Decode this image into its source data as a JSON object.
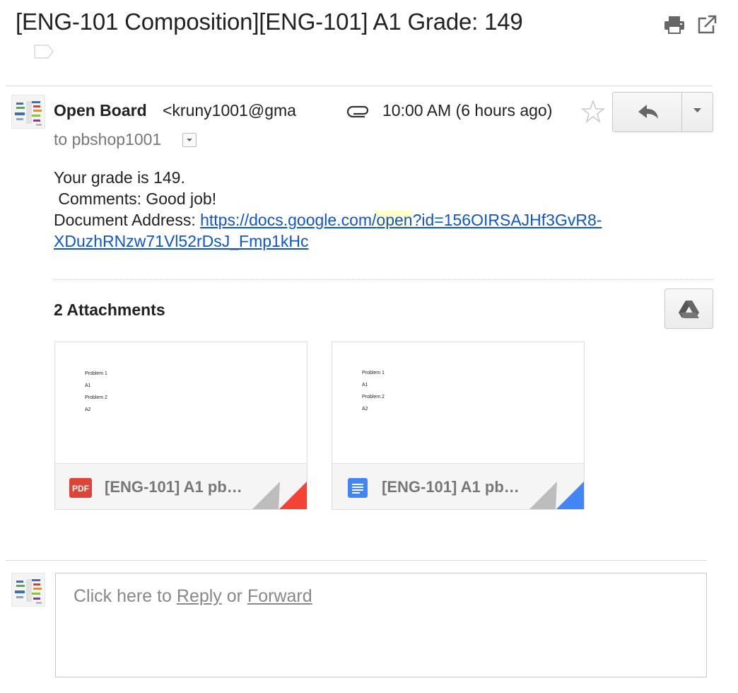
{
  "subject": "[ENG-101 Composition][ENG-101] A1 Grade: 149",
  "icons": {
    "label": "label-tag-icon",
    "print": "print-icon",
    "popout": "open-in-new-window-icon",
    "attachment": "paperclip-icon",
    "star": "star-icon",
    "reply": "reply-arrow-icon",
    "more": "chevron-down-icon",
    "drive": "google-drive-icon"
  },
  "message": {
    "sender_name": "Open Board",
    "sender_email": "<kruny1001@gma",
    "time": "10:00 AM (6 hours ago)",
    "to_line": "to pbshop1001",
    "body": {
      "line1": "Your grade is 149.",
      "line2": " Comments: Good job!",
      "address_label": "Document Address: ",
      "link_part1": "https://docs.google.com/",
      "link_highlight": "open",
      "link_part2": "?id=156OIRSAJHf3GvR8-",
      "link_part3": "XDuzhRNzw71Vl52rDsJ_Fmp1kHc"
    }
  },
  "attachments": {
    "title": "2 Attachments",
    "items": [
      {
        "name": "[ENG-101] A1 pb…",
        "type_badge": "PDF",
        "icon": "pdf-file-icon",
        "preview_lines": [
          "Problem 1",
          "A1",
          "Problem 2",
          "A2"
        ],
        "accent_color": "#f44336"
      },
      {
        "name": "[ENG-101] A1 pb…",
        "type_badge": "",
        "icon": "google-doc-file-icon",
        "preview_lines": [
          "Problem 1",
          "A1",
          "Problem 2",
          "A2"
        ],
        "accent_color": "#4285f4"
      }
    ]
  },
  "reply_box": {
    "prefix": "Click here to ",
    "reply": "Reply",
    "middle": " or ",
    "forward": "Forward"
  },
  "colors": {
    "link": "#1155cc",
    "highlight": "#ffffcc",
    "pdf_red": "#db4437",
    "doc_blue": "#4285f4"
  }
}
